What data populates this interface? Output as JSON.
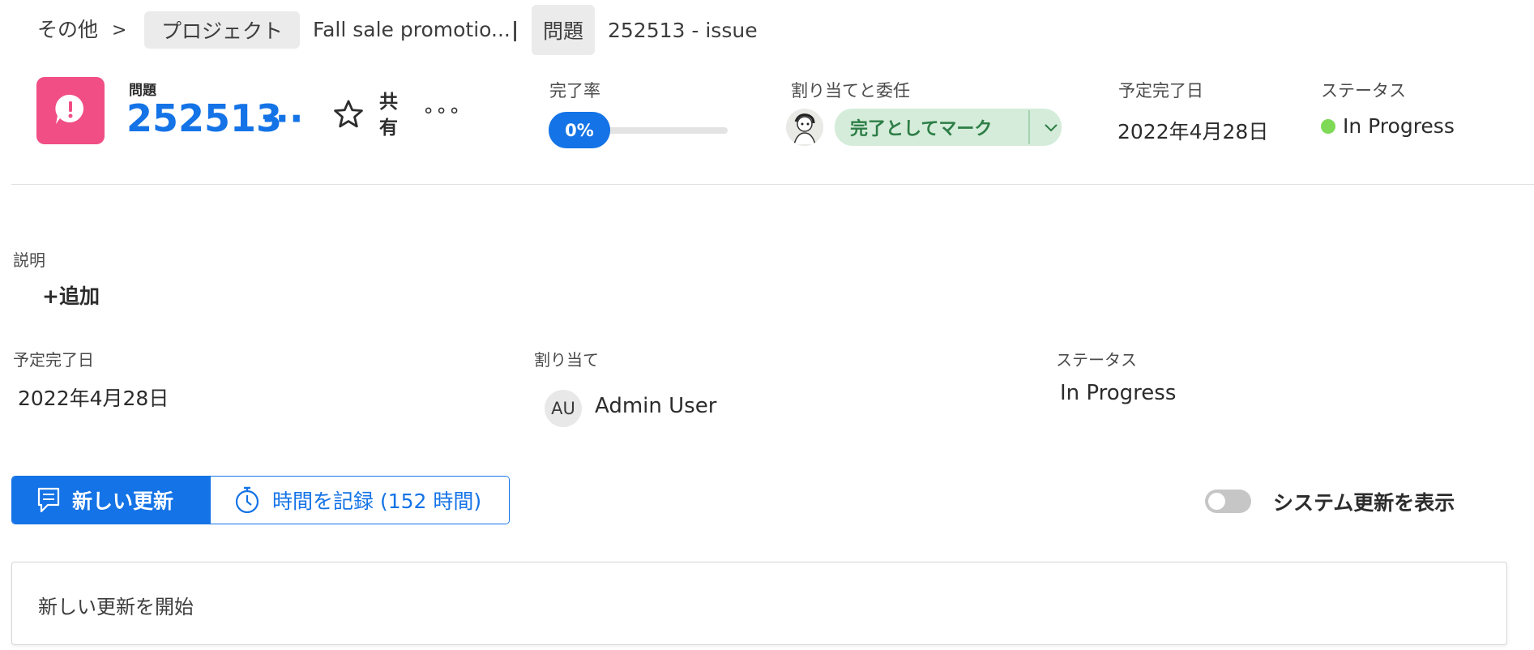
{
  "breadcrumb": {
    "other": "その他",
    "separator": ">",
    "project_pill": "プロジェクト",
    "project_name": "Fall sale promotio...",
    "pipe": "|",
    "issue_pill": "問題",
    "issue_name": "252513 - issue"
  },
  "header": {
    "icon": "issue-speech-bubble-icon",
    "tile_color": "#f04e84",
    "type_label": "問題",
    "issue_id": "252513",
    "id_more": "···",
    "share_label_line1": "共",
    "share_label_line2": "有",
    "more_actions": "∘∘∘"
  },
  "progress": {
    "label": "完了率",
    "value_text": "0%",
    "fraction": 0.0
  },
  "assignment": {
    "label": "割り当てと委任",
    "mark_complete": "完了としてマーク"
  },
  "due_date": {
    "label": "予定完了日",
    "value": "2022年4月28日"
  },
  "status": {
    "label": "ステータス",
    "value": "In Progress",
    "dot_color": "#7ed957"
  },
  "details": {
    "description_label": "説明",
    "add_link": "+追加",
    "due_label": "予定完了日",
    "due_value": "2022年4月28日",
    "assign_label": "割り当て",
    "assignee_initials": "AU",
    "assignee_name": "Admin User",
    "status_label": "ステータス",
    "status_value": "In Progress"
  },
  "updates": {
    "new_update_tab": "新しい更新",
    "log_time_tab": "時間を記録 (152 時間)",
    "system_toggle_label": "システム更新を表示",
    "system_toggle_on": false,
    "start_placeholder": "新しい更新を開始"
  },
  "colors": {
    "accent": "#1473e6",
    "complete_green_bg": "#d4ecd9",
    "complete_green_text": "#2d7d46"
  }
}
